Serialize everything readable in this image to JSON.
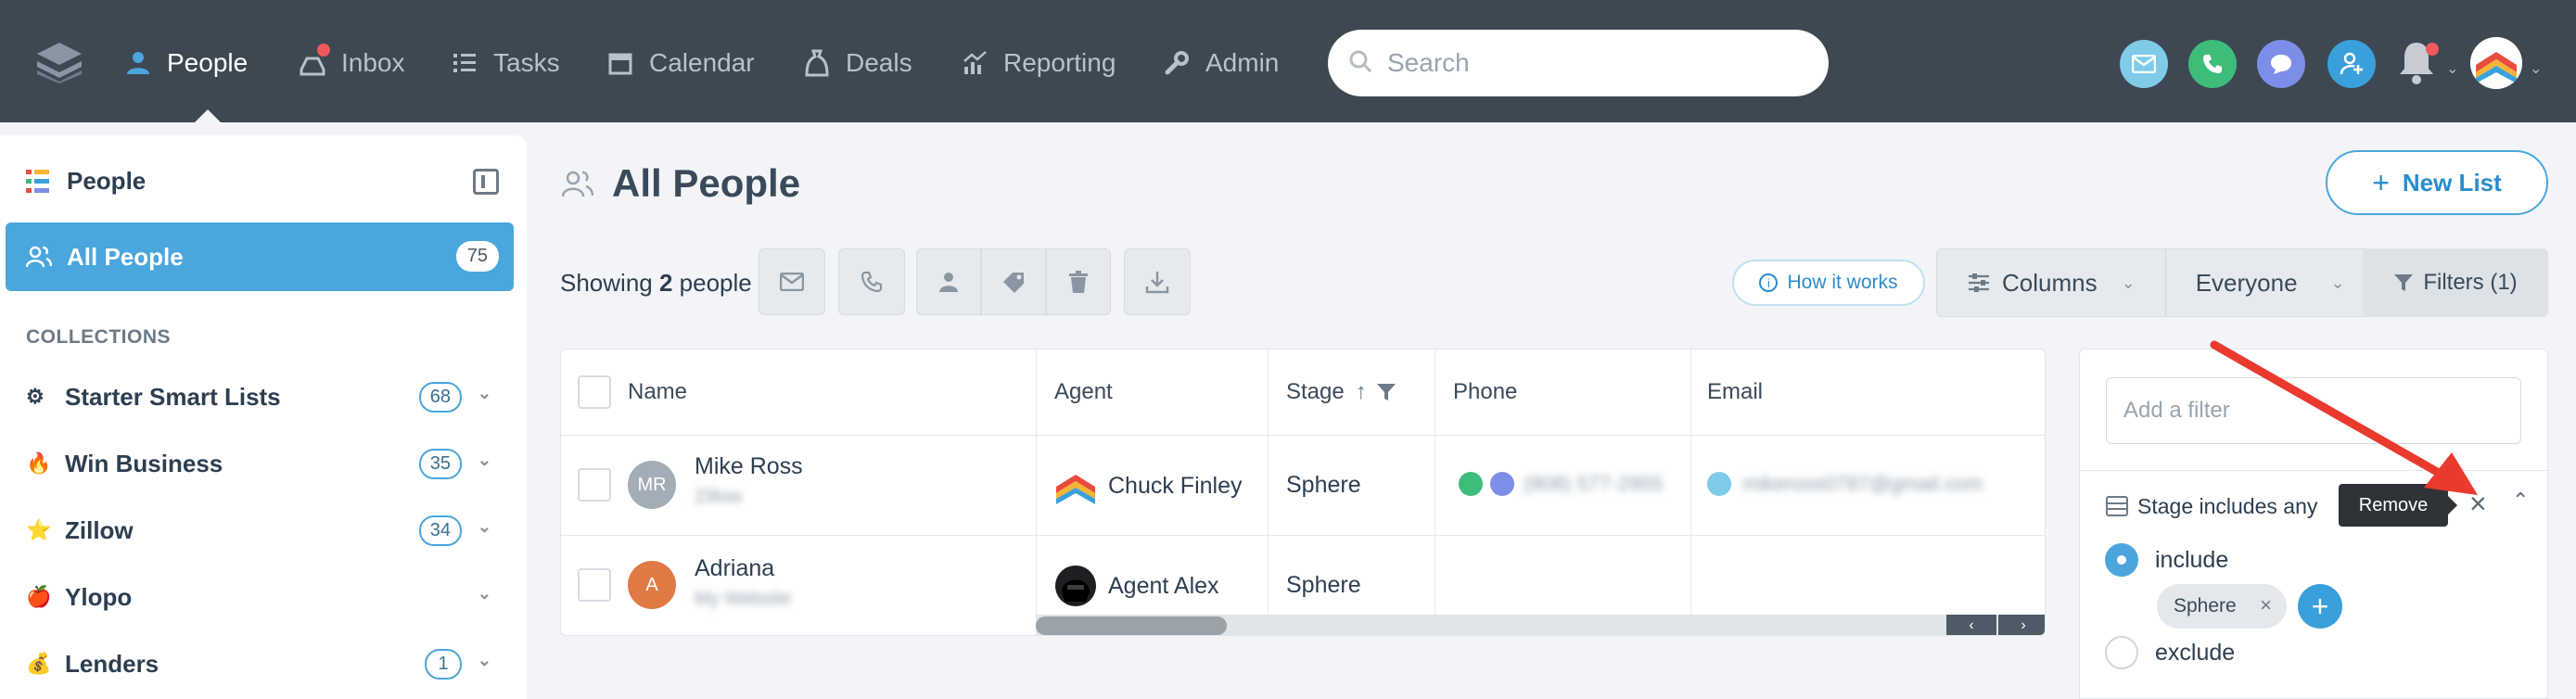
{
  "nav": {
    "items": [
      {
        "label": "People",
        "icon": "person-icon",
        "active": true
      },
      {
        "label": "Inbox",
        "icon": "inbox-icon",
        "badge": true
      },
      {
        "label": "Tasks",
        "icon": "list-icon"
      },
      {
        "label": "Calendar",
        "icon": "calendar-icon"
      },
      {
        "label": "Deals",
        "icon": "money-bag-icon"
      },
      {
        "label": "Reporting",
        "icon": "chart-icon"
      },
      {
        "label": "Admin",
        "icon": "wrench-icon"
      }
    ],
    "search_placeholder": "Search",
    "colors": {
      "bar": "#3d4853",
      "email": "#7fcbe8",
      "phone": "#3ebd7a",
      "chat": "#7d8ee8",
      "add_contact": "#3aa0dc",
      "notification": "#f0585a"
    }
  },
  "sidebar": {
    "title": "People",
    "active": {
      "label": "All People",
      "count": "75"
    },
    "section": "COLLECTIONS",
    "items": [
      {
        "label": "Starter Smart Lists",
        "emoji": "⚙",
        "count": "68"
      },
      {
        "label": "Win Business",
        "emoji": "🔥",
        "count": "35"
      },
      {
        "label": "Zillow",
        "emoji": "⭐",
        "count": "34"
      },
      {
        "label": "Ylopo",
        "emoji": "🍎",
        "count": ""
      },
      {
        "label": "Lenders",
        "emoji": "💰",
        "count": "1"
      }
    ]
  },
  "main": {
    "title": "All People",
    "new_list": "New List",
    "showing_prefix": "Showing",
    "showing_count": "2",
    "showing_suffix": "people",
    "how_it_works": "How it works",
    "columns_label": "Columns",
    "everyone_label": "Everyone",
    "filters_label": "Filters (1)"
  },
  "table": {
    "headers": {
      "name": "Name",
      "agent": "Agent",
      "stage": "Stage",
      "phone": "Phone",
      "email": "Email"
    },
    "rows": [
      {
        "initials": "MR",
        "name": "Mike Ross",
        "sub": "Zillow",
        "agent": "Chuck Finley",
        "stage": "Sphere",
        "phone": "(808) 577-2955",
        "email": "mikeross0787@gmail.com",
        "avatar_color": "#a3adb8"
      },
      {
        "initials": "A",
        "name": "Adriana",
        "sub": "My Website",
        "agent": "Agent Alex",
        "stage": "Sphere",
        "phone": "",
        "email": "",
        "avatar_color": "#e07a45"
      }
    ]
  },
  "filter_panel": {
    "add_placeholder": "Add a filter",
    "filter_label": "Stage includes any",
    "tooltip": "Remove",
    "include_label": "include",
    "exclude_label": "exclude",
    "selected_mode": "include",
    "chip": "Sphere"
  }
}
